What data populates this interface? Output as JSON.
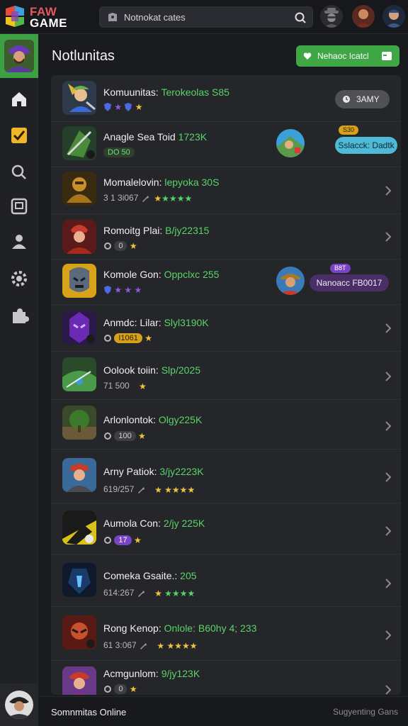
{
  "app": {
    "logo_line1": "FAW",
    "logo_line2": "GAME"
  },
  "search": {
    "value": "Notnokat cates"
  },
  "sidebar": {
    "items": [
      "home-icon",
      "checkbox-icon",
      "search-icon",
      "inbox-icon",
      "profile-icon",
      "gear-icon",
      "puzzle-icon"
    ]
  },
  "main": {
    "title": "Notlunitas",
    "cta_label": "Nehaoc Icatcl"
  },
  "rows": [
    {
      "title": "Komuunitas:",
      "highlight": "Terokeolas S85",
      "badge": "3AMY"
    },
    {
      "title": "Anagle Sea Toid",
      "highlight": "1723K",
      "meta_pill": "DO 50",
      "aux_top": "S30",
      "aux_badge": "Sslacck: Dadtk"
    },
    {
      "title": "Momalelovin:",
      "highlight": "lepyoka 30S",
      "meta": "3 1 3i067"
    },
    {
      "title": "Romoitg Plai:",
      "highlight": "B/jy22315",
      "meta_pill": "0"
    },
    {
      "title": "Komole Gon:",
      "highlight": "Oppclxc 255",
      "aux_top": "B8T",
      "aux_badge": "Nanoacc FB0017"
    },
    {
      "title": "Anmdc: Lilar:",
      "highlight": "Slyl3190K",
      "meta_pill": "I1061"
    },
    {
      "title": "Oolook toiin:",
      "highlight": "Slp/2025",
      "meta": "71 500"
    },
    {
      "title": "Arlonlontok:",
      "highlight": "Olgy225K",
      "meta_pill": "100"
    },
    {
      "title": "Arny Patiok:",
      "highlight": "3/jy2223K",
      "meta": "619/257"
    },
    {
      "title": "Aumola Con:",
      "highlight": "2/jy 225K",
      "meta_pill": "17"
    },
    {
      "title": "Comeka Gsaite.:",
      "highlight": "205",
      "meta": "614:267"
    },
    {
      "title": "Rong Kenop:",
      "highlight": "Onlole: B60hy 4; 233",
      "meta": "61 3:067"
    },
    {
      "title": "Acmgunlom:",
      "highlight": "9/jy123K",
      "meta_pill": "0"
    }
  ],
  "footer": {
    "left": "Somnmitas Online",
    "right": "Sugyenting Gans"
  },
  "colors": {
    "accent_green": "#3fa745",
    "highlight_green": "#59d468",
    "gold": "#f2c33c",
    "purple": "#7a43c6",
    "badge_blue": "#4fb9d8"
  }
}
